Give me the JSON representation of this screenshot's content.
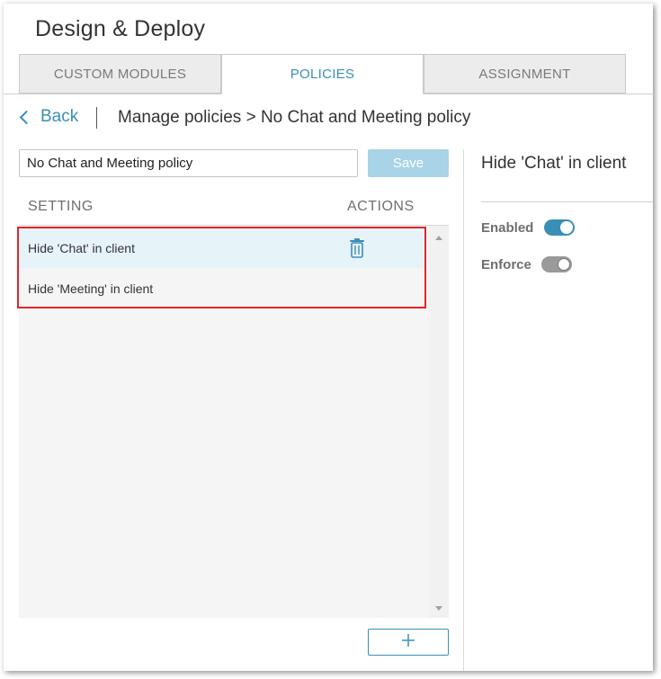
{
  "app": {
    "title": "Design & Deploy"
  },
  "tabs": [
    {
      "label": "CUSTOM MODULES",
      "active": false
    },
    {
      "label": "POLICIES",
      "active": true
    },
    {
      "label": "ASSIGNMENT",
      "active": false
    }
  ],
  "breadcrumb": {
    "back_label": "Back",
    "path": "Manage policies > No Chat and Meeting policy"
  },
  "policy_form": {
    "name_value": "No Chat and Meeting policy",
    "save_label": "Save"
  },
  "settings_table": {
    "columns": [
      "SETTING",
      "ACTIONS"
    ],
    "rows": [
      {
        "label": "Hide 'Chat' in client",
        "selected": true
      },
      {
        "label": "Hide 'Meeting' in client",
        "selected": false
      }
    ],
    "add_label": "+"
  },
  "details": {
    "title": "Hide 'Chat' in client",
    "enabled_label": "Enabled",
    "enabled": true,
    "enforce_label": "Enforce",
    "enforce": false
  },
  "colors": {
    "accent": "#3a8fb7",
    "highlight": "#e0262b",
    "selected_row": "#e6f3f9"
  },
  "icons": {
    "back": "chevron-left-icon",
    "delete": "trash-icon",
    "add": "plus-icon"
  }
}
